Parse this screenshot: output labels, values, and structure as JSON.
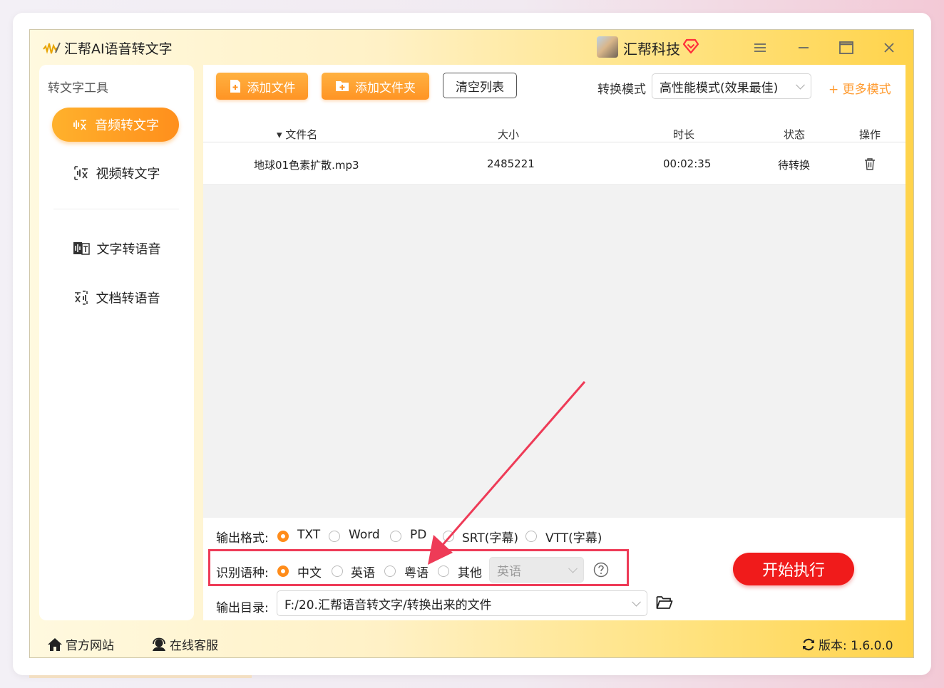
{
  "app": {
    "title": "汇帮AI语音转文字",
    "company": "汇帮科技"
  },
  "icons": {
    "logo": "waveform-logo-icon",
    "vip": "diamond-heart-icon",
    "menu": "hamburger-icon",
    "minimize": "minimize-icon",
    "maximize": "maximize-icon",
    "close": "close-icon",
    "audio": "audio-to-text-icon",
    "video": "video-to-text-icon",
    "tts": "text-to-speech-icon",
    "doc": "document-to-speech-icon",
    "add_file": "file-plus-icon",
    "add_folder": "folder-plus-icon",
    "delete": "trash-icon",
    "help": "question-circle-icon",
    "open_folder": "open-folder-icon",
    "home": "home-icon",
    "support": "headset-icon",
    "refresh": "refresh-icon"
  },
  "sidebar": {
    "header": "转文字工具",
    "items": [
      {
        "label": "音频转文字",
        "active": true
      },
      {
        "label": "视频转文字",
        "active": false
      },
      {
        "label": "文字转语音",
        "active": false
      },
      {
        "label": "文档转语音",
        "active": false
      }
    ]
  },
  "toolbar": {
    "add_file": "添加文件",
    "add_folder": "添加文件夹",
    "clear_list": "清空列表",
    "mode_label": "转换模式",
    "mode_value": "高性能模式(效果最佳)",
    "more_modes": "+ 更多模式"
  },
  "table": {
    "columns": [
      "▾ 文件名",
      "大小",
      "时长",
      "状态",
      "操作"
    ],
    "rows": [
      {
        "name": "地球01色素扩散.mp3",
        "size": "2485221",
        "duration": "00:02:35",
        "status": "待转换"
      }
    ]
  },
  "options": {
    "format_label": "输出格式:",
    "formats": [
      "TXT",
      "Word",
      "PDF",
      "SRT(字幕)",
      "VTT(字幕)"
    ],
    "format_selected": "TXT",
    "lang_label": "识别语种:",
    "langs": [
      "中文",
      "英语",
      "粤语",
      "其他"
    ],
    "lang_selected": "中文",
    "other_lang_value": "英语",
    "dir_label": "输出目录:",
    "dir_value": "F:/20.汇帮语音转文字/转换出来的文件",
    "start": "开始执行"
  },
  "footer": {
    "website": "官方网站",
    "support": "在线客服",
    "version": "版本: 1.6.0.0"
  },
  "colors": {
    "accent": "#ff9424",
    "start": "#f01b1b",
    "highlight": "#ee3b57"
  }
}
